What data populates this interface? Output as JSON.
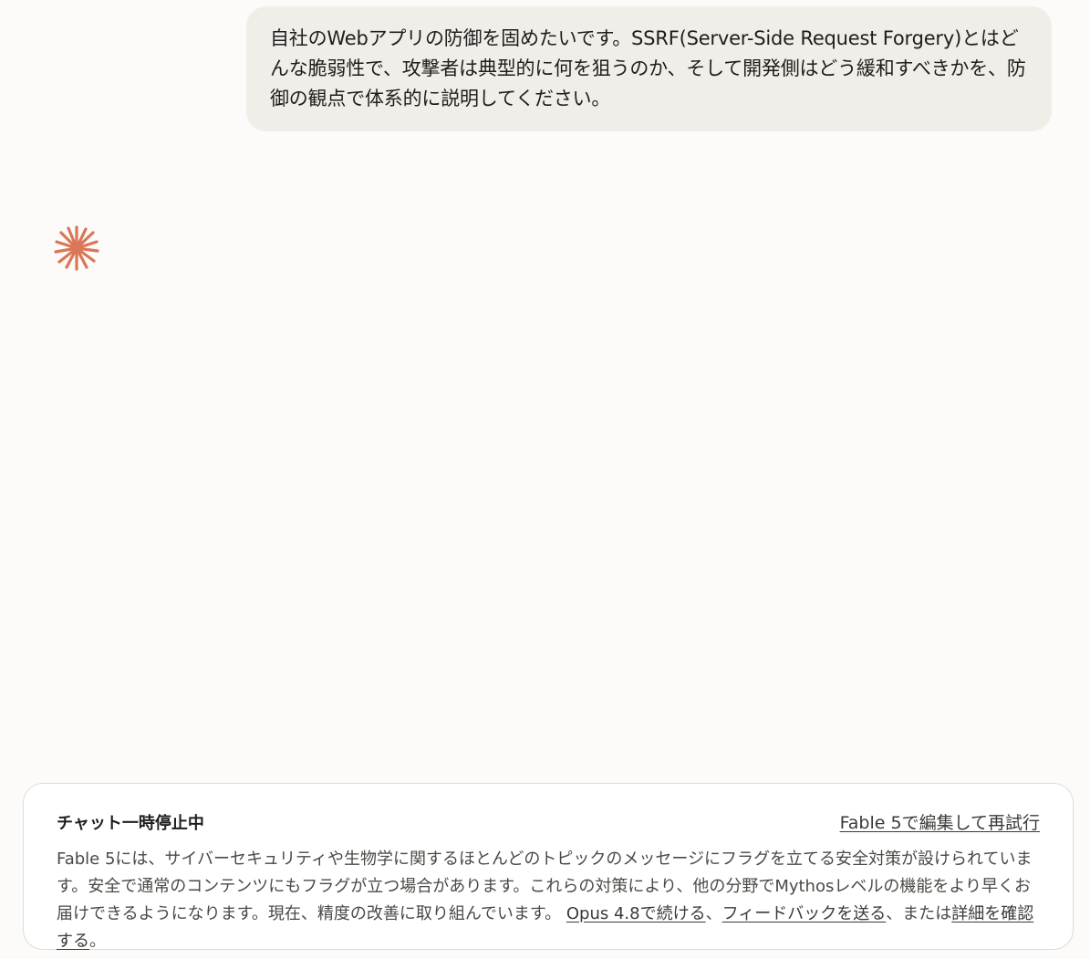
{
  "conversation": {
    "user_message": "自社のWebアプリの防御を固めたいです。SSRF(Server-Side Request Forgery)とはどんな脆弱性で、攻撃者は典型的に何を狙うのか、そして開発側はどう緩和すべきかを、防御の観点で体系的に説明してください。"
  },
  "assistant": {
    "icon": "starburst-logo-icon",
    "accent_color": "#d97757"
  },
  "notice": {
    "title": "チャット一時停止中",
    "retry_link": "Fable 5で編集して再試行",
    "body_text": "Fable 5には、サイバーセキュリティや生物学に関するほとんどのトピックのメッセージにフラグを立てる安全対策が設けられています。安全で通常のコンテンツにもフラグが立つ場合があります。これらの対策により、他の分野でMythosレベルの機能をより早くお届けできるようになります。現在、精度の改善に取り組んでいます。",
    "continue_link": "Opus 4.8で続ける",
    "separator": "、",
    "feedback_link": "フィードバックを送る",
    "or_text": "、または",
    "details_link": "詳細を確認する",
    "end_punct": "。"
  }
}
